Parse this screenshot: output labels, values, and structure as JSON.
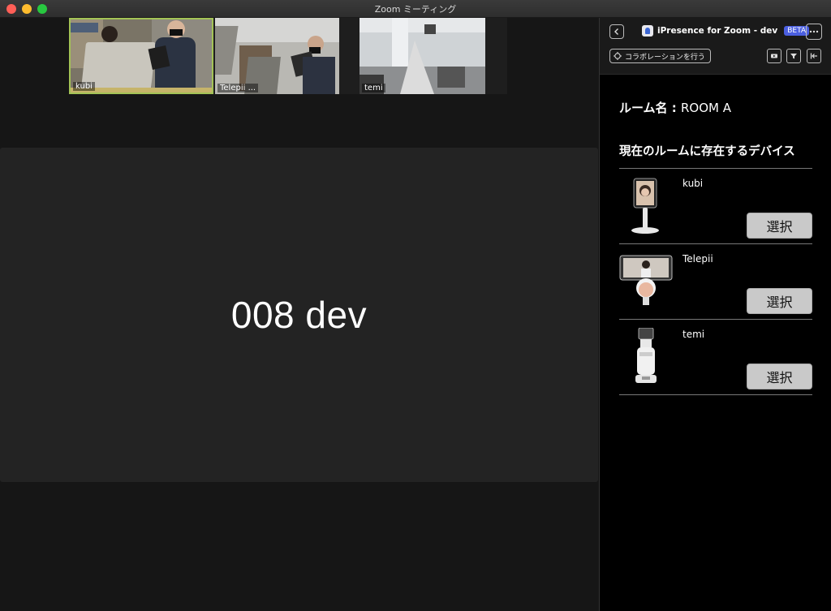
{
  "window": {
    "title": "Zoom ミーティング"
  },
  "meeting": {
    "thumbnails": [
      {
        "label": "kubi"
      },
      {
        "label": "Telepii ..."
      },
      {
        "label": "temi"
      }
    ],
    "speaker_name": "008 dev"
  },
  "panel": {
    "app_name": "iPresence for Zoom - dev",
    "badge": "BETA",
    "collab_label": "コラボレーションを行う",
    "room_prefix": "ルーム名 : ",
    "room_name": "ROOM A",
    "section_title": "現在のルームに存在するデバイス",
    "devices": [
      {
        "name": "kubi",
        "button": "選択"
      },
      {
        "name": "Telepii",
        "button": "選択"
      },
      {
        "name": "temi",
        "button": "選択"
      }
    ]
  },
  "colors": {
    "accent": "#4b5fe0",
    "active_border": "#a3c356",
    "button": "#c9c9c9"
  },
  "icons": [
    "back-icon",
    "more-icon",
    "collab-icon",
    "video-icon",
    "filter-icon",
    "collapse-icon"
  ]
}
